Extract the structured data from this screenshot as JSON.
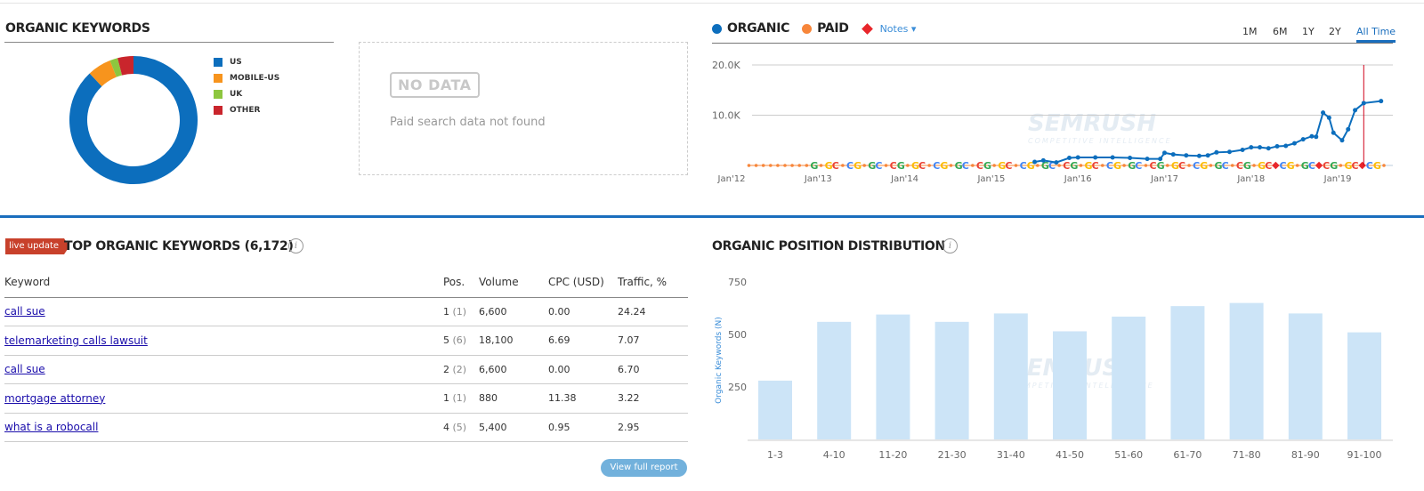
{
  "organic_keywords": {
    "title": "ORGANIC KEYWORDS",
    "segments": [
      {
        "label": "US",
        "share": 88,
        "color": "#0c6ebd"
      },
      {
        "label": "MOBILE-US",
        "share": 6,
        "color": "#f7941d"
      },
      {
        "label": "UK",
        "share": 2,
        "color": "#8dc63f"
      },
      {
        "label": "OTHER",
        "share": 4,
        "color": "#c9252c"
      }
    ]
  },
  "paid": {
    "badge": "NO DATA",
    "message": "Paid search data not found"
  },
  "trend": {
    "legend": {
      "organic": "ORGANIC",
      "paid": "PAID",
      "notes": "Notes"
    },
    "colors": {
      "organic": "#0c6ebd",
      "paid": "#f7863a",
      "notes": "#e8262b"
    },
    "periods": [
      "1M",
      "6M",
      "1Y",
      "2Y",
      "All Time"
    ],
    "active_period": "All Time",
    "chart_data": {
      "type": "line",
      "y_ticks": [
        "20.0K",
        "10.0K"
      ],
      "ylim": [
        0,
        20000
      ],
      "x_ticks": [
        "Jan'12",
        "Jan'13",
        "Jan'14",
        "Jan'15",
        "Jan'16",
        "Jan'17",
        "Jan'18",
        "Jan'19"
      ],
      "series": [
        {
          "name": "ORGANIC",
          "points": [
            [
              2015.5,
              700
            ],
            [
              2015.6,
              1000
            ],
            [
              2015.75,
              600
            ],
            [
              2015.9,
              1500
            ],
            [
              2016.0,
              1600
            ],
            [
              2016.2,
              1600
            ],
            [
              2016.4,
              1600
            ],
            [
              2016.6,
              1500
            ],
            [
              2016.8,
              1300
            ],
            [
              2016.95,
              1300
            ],
            [
              2017.0,
              2500
            ],
            [
              2017.1,
              2200
            ],
            [
              2017.25,
              2000
            ],
            [
              2017.4,
              1900
            ],
            [
              2017.5,
              2000
            ],
            [
              2017.6,
              2600
            ],
            [
              2017.75,
              2700
            ],
            [
              2017.9,
              3100
            ],
            [
              2018.0,
              3600
            ],
            [
              2018.1,
              3600
            ],
            [
              2018.2,
              3400
            ],
            [
              2018.3,
              3800
            ],
            [
              2018.4,
              3900
            ],
            [
              2018.5,
              4400
            ],
            [
              2018.6,
              5200
            ],
            [
              2018.7,
              5800
            ],
            [
              2018.75,
              5700
            ],
            [
              2018.83,
              10500
            ],
            [
              2018.9,
              9500
            ],
            [
              2018.95,
              6500
            ],
            [
              2019.05,
              5000
            ],
            [
              2019.12,
              7200
            ],
            [
              2019.2,
              11000
            ],
            [
              2019.3,
              12400
            ],
            [
              2019.5,
              12800
            ]
          ]
        }
      ],
      "marker_line": "2019.3"
    }
  },
  "top_keywords": {
    "badge": "live update",
    "title": "TOP ORGANIC KEYWORDS (6,172)",
    "info": "i",
    "columns": [
      "Keyword",
      "Pos.",
      "Volume",
      "CPC (USD)",
      "Traffic, %"
    ],
    "rows": [
      {
        "keyword": "call sue",
        "pos": "1",
        "prev": "(1)",
        "volume": "6,600",
        "cpc": "0.00",
        "traffic": "24.24"
      },
      {
        "keyword": "telemarketing calls lawsuit",
        "pos": "5",
        "prev": "(6)",
        "volume": "18,100",
        "cpc": "6.69",
        "traffic": "7.07"
      },
      {
        "keyword": "call sue",
        "pos": "2",
        "prev": "(2)",
        "volume": "6,600",
        "cpc": "0.00",
        "traffic": "6.70"
      },
      {
        "keyword": "mortgage attorney",
        "pos": "1",
        "prev": "(1)",
        "volume": "880",
        "cpc": "11.38",
        "traffic": "3.22"
      },
      {
        "keyword": "what is a robocall",
        "pos": "4",
        "prev": "(5)",
        "volume": "5,400",
        "cpc": "0.95",
        "traffic": "2.95"
      }
    ],
    "view_full": "View full report"
  },
  "position_distribution": {
    "title": "ORGANIC POSITION DISTRIBUTION",
    "info": "i",
    "chart_data": {
      "type": "bar",
      "ylabel": "Organic Keywords (N)",
      "y_ticks": [
        750,
        500,
        250
      ],
      "ylim": [
        0,
        800
      ],
      "color": "#cce4f7",
      "categories": [
        "1-3",
        "4-10",
        "11-20",
        "21-30",
        "31-40",
        "41-50",
        "51-60",
        "61-70",
        "71-80",
        "81-90",
        "91-100"
      ],
      "values": [
        280,
        560,
        595,
        560,
        600,
        515,
        585,
        635,
        650,
        600,
        510
      ]
    }
  },
  "watermark": {
    "brand": "SEMRUSH",
    "tagline": "COMPETITIVE INTELLIGENCE"
  }
}
